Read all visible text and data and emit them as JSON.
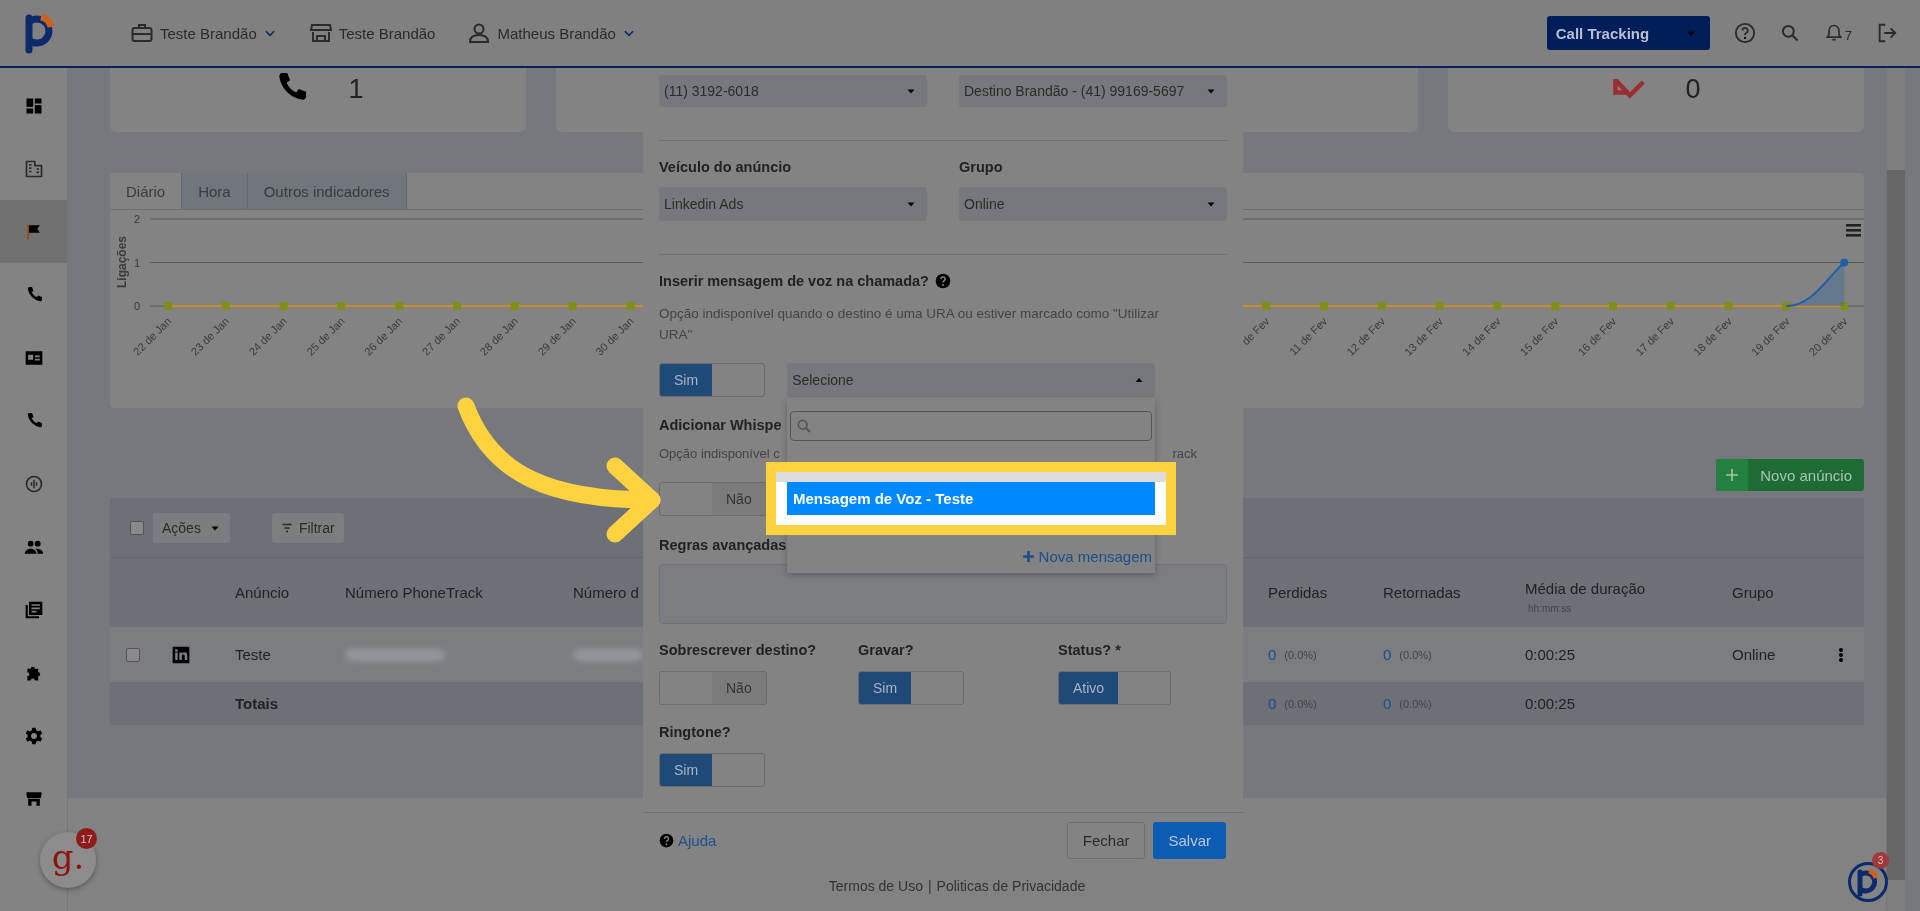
{
  "topbar": {
    "nav": [
      {
        "kind": "company",
        "label": "Teste Brandão",
        "dropdown": true
      },
      {
        "kind": "store",
        "label": "Teste Brandão",
        "dropdown": false
      },
      {
        "kind": "user",
        "label": "Matheus Brandão",
        "dropdown": true
      }
    ],
    "product_select": "Call Tracking",
    "notification_count": "7"
  },
  "sidebar": {
    "items": [
      {
        "kind": "dashboard",
        "selected": false
      },
      {
        "kind": "building",
        "selected": false
      },
      {
        "kind": "flag",
        "selected": true
      },
      {
        "kind": "phone",
        "selected": false
      },
      {
        "kind": "contact",
        "selected": false
      },
      {
        "kind": "phone",
        "selected": false
      },
      {
        "kind": "audio",
        "selected": false
      },
      {
        "kind": "people",
        "selected": false
      },
      {
        "kind": "book",
        "selected": false
      },
      {
        "kind": "puzzle",
        "selected": false
      },
      {
        "kind": "settings",
        "selected": false
      },
      {
        "kind": "store",
        "selected": false
      }
    ]
  },
  "summary_cards": [
    {
      "kind": "calls",
      "value": "1"
    },
    {
      "kind": "missed",
      "value": "0"
    }
  ],
  "chart_panel": {
    "tabs": [
      {
        "label": "Diário",
        "selected": true
      },
      {
        "label": "Hora",
        "selected": false
      },
      {
        "label": "Outros indicadores",
        "selected": false
      }
    ],
    "chart_data": {
      "type": "line",
      "ylabel": "Ligações",
      "yticks": [
        0,
        1,
        2
      ],
      "ylim": [
        0,
        2
      ],
      "categories": [
        "22 de Jan",
        "23 de Jan",
        "24 de Jan",
        "25 de Jan",
        "26 de Jan",
        "27 de Jan",
        "28 de Jan",
        "29 de Jan",
        "30 de Jan",
        "de Fev",
        "11 de Fev",
        "12 de Fev",
        "13 de Fev",
        "14 de Fev",
        "15 de Fev",
        "16 de Fev",
        "17 de Fev",
        "18 de Fev",
        "19 de Fev",
        "20 de Fev"
      ],
      "series": [
        {
          "color": "#c98a2a",
          "marker": "square",
          "values": [
            0,
            0,
            0,
            0,
            0,
            0,
            0,
            0,
            0,
            0,
            0,
            0,
            0,
            0,
            0,
            0,
            0,
            0,
            0,
            0
          ]
        },
        {
          "color": "#1f5fa8",
          "marker": "circle",
          "values": [
            null,
            null,
            null,
            null,
            null,
            null,
            null,
            null,
            null,
            null,
            null,
            null,
            null,
            null,
            null,
            null,
            null,
            null,
            0,
            1
          ]
        }
      ]
    }
  },
  "ads_table": {
    "new_button": "Novo anúncio",
    "select_all_checked": false,
    "actions": "Ações",
    "filter": "Filtrar",
    "columns": [
      {
        "label": "Anúncio"
      },
      {
        "label": "Número PhoneTrack"
      },
      {
        "label": "Número d"
      },
      {
        "label": "Perdidas"
      },
      {
        "label": "Retornadas"
      },
      {
        "label": "Média de duração",
        "sub": "hh:mm:ss"
      },
      {
        "label": "Grupo"
      }
    ],
    "rows": [
      {
        "checked": false,
        "ad": "Teste",
        "lost": {
          "value": "0",
          "pct": "(0.0%)"
        },
        "returned": {
          "value": "0",
          "pct": "(0.0%)"
        },
        "avg": "0:00:25",
        "group": "Online"
      }
    ],
    "totals": {
      "label": "Totais",
      "lost": {
        "value": "0",
        "pct": "(0.0%)"
      },
      "returned": {
        "value": "0",
        "pct": "(0.0%)"
      },
      "avg": "0:00:25"
    }
  },
  "modal": {
    "top_selects": [
      "(11) 3192-6018",
      "Destino Brandão - (41) 99169-5697"
    ],
    "fields": [
      {
        "label": "Veículo do anúncio",
        "value": "Linkedin Ads"
      },
      {
        "label": "Grupo",
        "value": "Online"
      }
    ],
    "voice_message": {
      "title": "Inserir mensagem de voz na chamada?",
      "description": "Opção indisponível quando o destino é uma URA ou estiver marcado como \"Utilizar URA\"",
      "toggle": {
        "on": true,
        "label": "Sim"
      },
      "select": {
        "value": "Selecione",
        "expanded": true
      }
    },
    "dropdown": {
      "options": [
        {
          "label": "Mensagem de Voz - Teste",
          "selected": true
        }
      ],
      "add_link": "Nova mensagem"
    },
    "whisper": {
      "title": "Adicionar Whispe",
      "description_start": "Opção indisponível c",
      "description_end": "rack",
      "toggle": {
        "on": false,
        "label": "Não"
      }
    },
    "advanced_rules": {
      "title": "Regras avançadas"
    },
    "switches": [
      {
        "label": "Sobrescrever destino?",
        "toggle": {
          "on": false,
          "label": "Não"
        }
      },
      {
        "label": "Gravar?",
        "toggle": {
          "on": true,
          "label": "Sim"
        }
      },
      {
        "label": "Status? *",
        "toggle": {
          "on": true,
          "label": "Ativo"
        }
      },
      {
        "label": "Ringtone?",
        "toggle": {
          "on": true,
          "label": "Sim"
        }
      }
    ],
    "help_link": "Ajuda",
    "buttons": [
      {
        "kind": "secondary",
        "label": "Fechar"
      },
      {
        "kind": "primary",
        "label": "Salvar"
      }
    ]
  },
  "footer": {
    "links": [
      "Termos de Uso",
      "Politicas de Privacidade"
    ],
    "separator": "|"
  },
  "chat_widget": {
    "label": "g.",
    "count": "17"
  },
  "help_widget": {
    "count": "3"
  }
}
